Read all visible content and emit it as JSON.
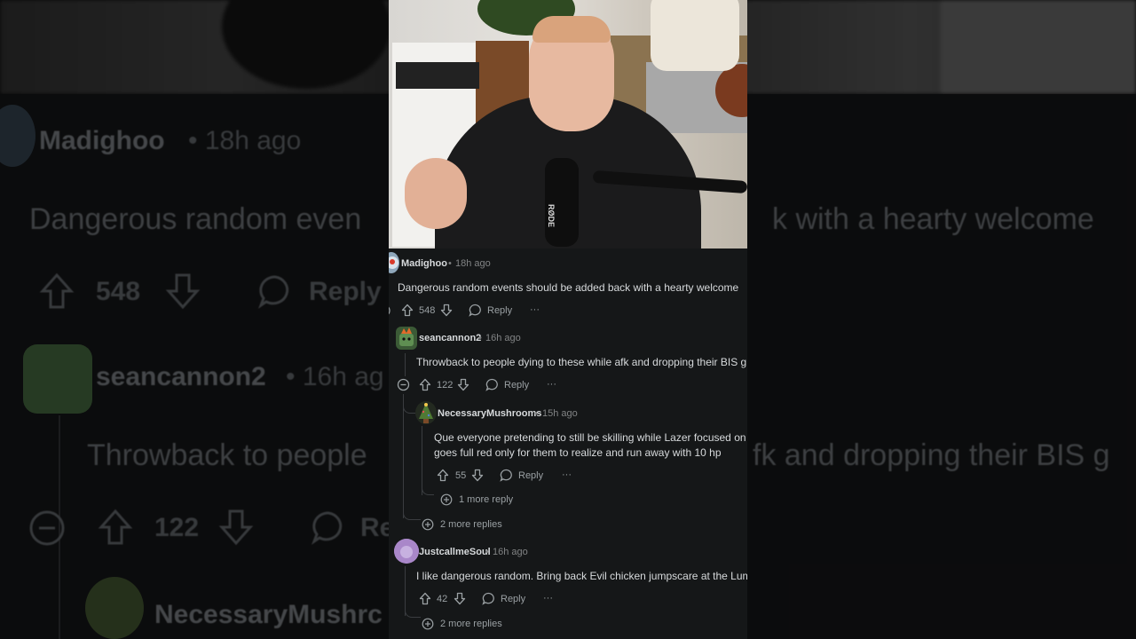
{
  "comments": [
    {
      "username": "Madighoo",
      "time": "18h ago",
      "body": "Dangerous random events should be added back with a hearty welcome",
      "score": "548",
      "reply_label": "Reply",
      "more_label": "···"
    },
    {
      "username": "seancannon2",
      "time": "16h ago",
      "body": "Throwback to people dying to these while afk and dropping their BIS g",
      "score": "122",
      "reply_label": "Reply",
      "more_label": "···"
    },
    {
      "username": "NecessaryMushrooms",
      "time": "15h ago",
      "body_line1": "Que everyone pretending to still be skilling while Lazer focused on",
      "body_line2": "goes full red only for them to realize and run away with 10 hp",
      "score": "55",
      "reply_label": "Reply",
      "more_label": "···"
    },
    {
      "username": "JustcallmeSoul",
      "time": "16h ago",
      "body": "I like dangerous random. Bring back Evil chicken jumpscare at the Lum",
      "score": "42",
      "reply_label": "Reply",
      "more_label": "···"
    }
  ],
  "thread": {
    "one_more_reply": "1 more reply",
    "two_more_replies_a": "2 more replies",
    "two_more_replies_b": "2 more replies",
    "separator": "•"
  },
  "background": {
    "username_1": "Madighoo",
    "time_1": "• 18h ago",
    "body_1_left": "Dangerous random even",
    "body_1_right": "k with a hearty welcome",
    "score_1": "548",
    "reply_1": "Reply",
    "username_2": "seancannon2",
    "time_2": "• 16h ag",
    "body_2_left": "Throwback to people",
    "body_2_right": "fk and dropping their BIS g",
    "score_2": "122",
    "reply_2": "Re",
    "username_3": "NecessaryMushrc"
  },
  "video": {
    "mic_brand": "RØDE"
  },
  "colors": {
    "panel_bg": "#151718",
    "text_primary": "#d7dadc",
    "text_meta": "#818384",
    "thread_line": "#3a3d40"
  }
}
